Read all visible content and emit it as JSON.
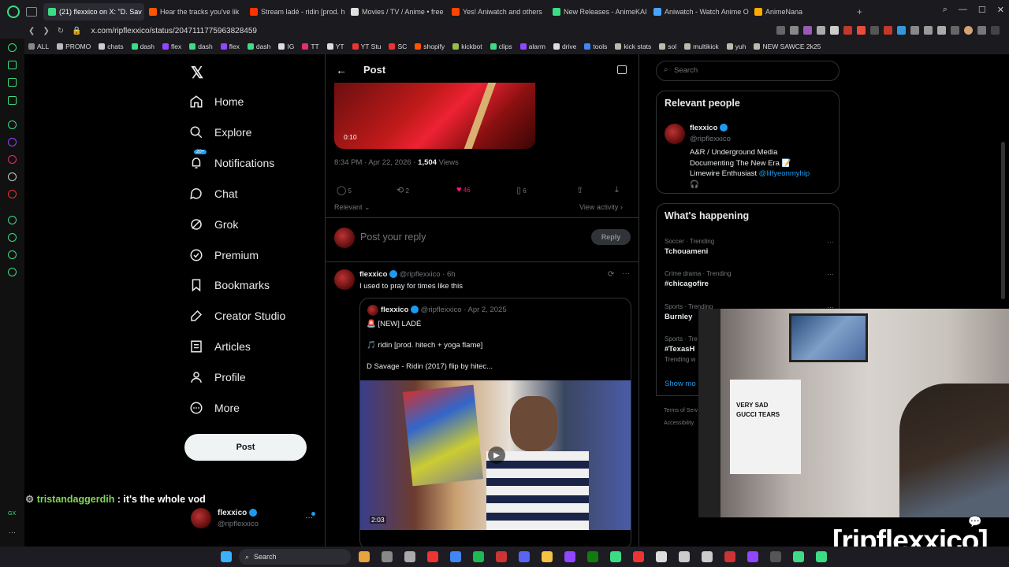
{
  "browser": {
    "tabs": [
      {
        "label": "(21) flexxico on X: \"D. Sav",
        "color": "#3ddc84",
        "active": true
      },
      {
        "label": "Hear the tracks you've lik",
        "color": "#ff5500",
        "active": false
      },
      {
        "label": "Stream ladé - ridin [prod. h",
        "color": "#ff3300",
        "active": false
      },
      {
        "label": "Movies / TV / Anime • free",
        "color": "#e0e0e0",
        "active": false
      },
      {
        "label": "Yes! Aniwatch and others",
        "color": "#ff4500",
        "active": false
      },
      {
        "label": "New Releases - AnimeKAI",
        "color": "#3ddc84",
        "active": false
      },
      {
        "label": "Aniwatch - Watch Anime O",
        "color": "#4aa3ff",
        "active": false
      },
      {
        "label": "AnimeNana",
        "color": "#ffaa00",
        "active": false
      }
    ],
    "url": "x.com/ripflexxico/status/2047111775963828459",
    "bookmarks": [
      "ALL",
      "PROMO",
      "chats",
      "dash",
      "flex",
      "dash",
      "flex",
      "dash",
      "IG",
      "TT",
      "YT",
      "YT Stu",
      "SC",
      "shopify",
      "kickbot",
      "clips",
      "alarm",
      "drive",
      "tools",
      "kick stats",
      "sol",
      "multikick",
      "yuh",
      "NEW SAWCE 2k25"
    ]
  },
  "nav": {
    "items": [
      "Home",
      "Explore",
      "Notifications",
      "Chat",
      "Grok",
      "Premium",
      "Bookmarks",
      "Creator Studio",
      "Articles",
      "Profile",
      "More"
    ],
    "notif_badge": "20+",
    "post_button": "Post",
    "account_name": "flexxico",
    "account_handle": "@ripflexxico"
  },
  "header": {
    "title": "Post"
  },
  "post": {
    "video_time": "0:10",
    "timestamp": "8:34 PM · Apr 22, 2026 · ",
    "views_count": "1,504",
    "views_label": " Views",
    "replies": "5",
    "reposts": "2",
    "likes": "46",
    "bookmarks": "6",
    "sort_label": "Relevant",
    "view_activity": "View activity",
    "reply_placeholder": "Post your reply",
    "reply_button": "Reply"
  },
  "reply": {
    "name": "flexxico",
    "handle": "@ripflexxico",
    "age": "6h",
    "text": "I used to pray for times like this",
    "quote": {
      "name": "flexxico",
      "handle": "@ripflexxico",
      "date": "Apr 2, 2025",
      "line1": "🚨 [NEW] LADÉ",
      "line2": "🎵 ridin [prod. hitech + yoga flame]",
      "line3": "D Savage - Ridin (2017) flip by hitec...",
      "video_time": "2:03"
    }
  },
  "search": {
    "placeholder": "Search"
  },
  "relevant": {
    "title": "Relevant people",
    "name": "flexxico",
    "handle": "@ripflexxico",
    "bio1": "A&R / Underground Media",
    "bio2": "Documenting The New Era 📝",
    "bio3": "Limewire Enthusiast ",
    "bio_link": "@lilfyeonmyhip",
    "bio4": "🎧"
  },
  "trending": {
    "title": "What's happening",
    "items": [
      {
        "category": "Soccer · Trending",
        "topic": "Tchouameni"
      },
      {
        "category": "Crime drama · Trending",
        "topic": "#chicagofire"
      },
      {
        "category": "Sports · Trending",
        "topic": "Burnley"
      },
      {
        "category": "Sports · Tre",
        "topic": "#TexasH"
      }
    ],
    "trending_with": "Trending w",
    "show_more": "Show mo",
    "terms": "Terms of Serv",
    "access": "Accessibility"
  },
  "chat_overlay": {
    "user": "tristandaggerdih",
    "message": " : it's the whole vod"
  },
  "watermark": "[ripflexxico]",
  "webcam": {
    "shirt_line1": "VERY SAD",
    "shirt_line2": "GUCCI TEARS"
  },
  "taskbar": {
    "search": "Search"
  }
}
